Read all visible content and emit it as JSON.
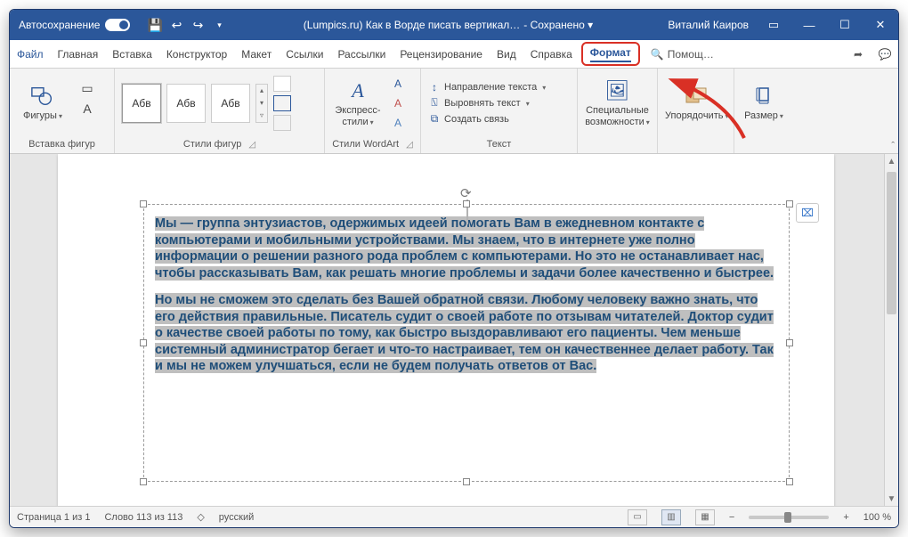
{
  "titlebar": {
    "autosave_label": "Автосохранение",
    "doc_name": "(Lumpics.ru) Как в Ворде писать вертикал…",
    "save_state": "Сохранено",
    "user": "Виталий Каиров"
  },
  "tabs": {
    "file": "Файл",
    "home": "Главная",
    "insert": "Вставка",
    "design": "Конструктор",
    "layout": "Макет",
    "references": "Ссылки",
    "mailings": "Рассылки",
    "review": "Рецензирование",
    "view": "Вид",
    "help": "Справка",
    "format": "Формат",
    "search": "Помощ…"
  },
  "ribbon": {
    "shapes": {
      "button": "Фигуры",
      "group": "Вставка фигур"
    },
    "styles": {
      "sample": "Абв",
      "group": "Стили фигур"
    },
    "wordart": {
      "button": "Экспресс-стили",
      "group": "Стили WordArt"
    },
    "text": {
      "direction": "Направление текста",
      "align": "Выровнять текст",
      "link": "Создать связь",
      "group": "Текст"
    },
    "access": {
      "button": "Специальные возможности"
    },
    "arrange": {
      "button": "Упорядочить"
    },
    "size": {
      "button": "Размер"
    }
  },
  "document": {
    "para1": "Мы — группа энтузиастов, одержимых идеей помогать Вам в ежедневном контакте с компьютерами и мобильными устройствами. Мы знаем, что в интернете уже полно информации о решении разного рода проблем с компьютерами. Но это не останавливает нас, чтобы рассказывать Вам, как решать многие проблемы и задачи более качественно и быстрее.",
    "para2": "Но мы не сможем это сделать без Вашей обратной связи. Любому человеку важно знать, что его действия правильные. Писатель судит о своей работе по отзывам читателей. Доктор судит о качестве своей работы по тому, как быстро выздоравливают его пациенты. Чем меньше системный администратор бегает и что-то настраивает, тем он качественнее делает работу. Так и мы не можем улучшаться, если не будем получать ответов от Вас."
  },
  "statusbar": {
    "page": "Страница 1 из 1",
    "words": "Слово 113 из 113",
    "lang": "русский",
    "zoom": "100 %"
  }
}
